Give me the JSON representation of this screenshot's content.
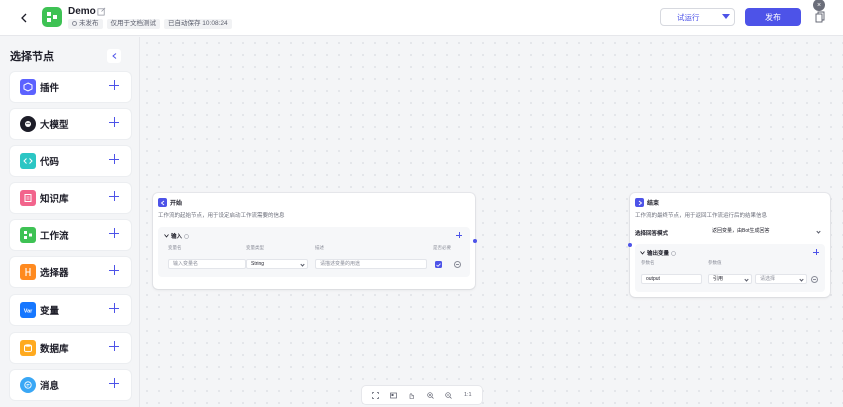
{
  "header": {
    "app_name": "Demo",
    "status": "未发布",
    "scope": "仅用于文档测试",
    "autosave": "已自动保存 10:08:24",
    "run_label": "试运行",
    "publish_label": "发布",
    "close_label": "×"
  },
  "sidebar": {
    "title": "选择节点",
    "items": [
      {
        "label": "插件",
        "icon": "plugin-icon",
        "color": "#5c62ff"
      },
      {
        "label": "大模型",
        "icon": "llm-icon",
        "color": "#1d1d28"
      },
      {
        "label": "代码",
        "icon": "code-icon",
        "color": "#2bc6c4"
      },
      {
        "label": "知识库",
        "icon": "knowledge-icon",
        "color": "#f2648c"
      },
      {
        "label": "工作流",
        "icon": "workflow-icon",
        "color": "#3ec254"
      },
      {
        "label": "选择器",
        "icon": "selector-icon",
        "color": "#ff8a1f"
      },
      {
        "label": "变量",
        "icon": "variable-icon",
        "color": "#1677ff"
      },
      {
        "label": "数据库",
        "icon": "database-icon",
        "color": "#ffaa1f"
      },
      {
        "label": "消息",
        "icon": "message-icon",
        "color": "#3aa7f5"
      }
    ]
  },
  "start_node": {
    "title": "开始",
    "desc": "工作流的起始节点，用于设定启动工作流需要的信息",
    "section_title": "输入",
    "col_name": "变量名",
    "col_type": "变量类型",
    "col_desc": "描述",
    "col_required": "是否必要",
    "name_placeholder": "输入变量名",
    "type_value": "String",
    "desc_placeholder": "请描述变量的用途"
  },
  "end_node": {
    "title": "结束",
    "desc": "工作流的最终节点，用于返回工作流运行后的结果信息",
    "mode_label": "选择回答模式",
    "mode_value": "返回变量，由Bot生成回答",
    "section_title": "输出变量",
    "col_name": "参数名",
    "col_value": "参数值",
    "param_name": "output",
    "ref_value": "引用",
    "select_placeholder": "请选择"
  },
  "toolbar": {
    "zoom_label": "1:1"
  },
  "colors": {
    "accent": "#4d53e8",
    "canvas": "#f4f5f7"
  }
}
